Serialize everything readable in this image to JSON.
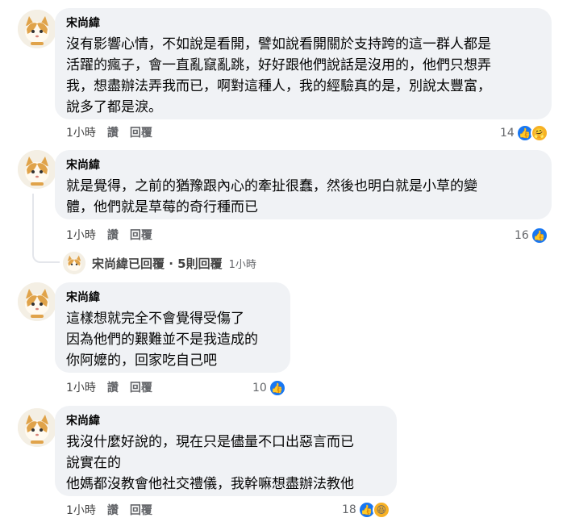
{
  "comments": [
    {
      "author": "宋尚緯",
      "lines": [
        "沒有影響心情，不如說是看開，譬如說看開關於支持跨的這一群人都是",
        "活躍的瘋子，會一直亂竄亂跳，好好跟他們說話是沒用的，他們只想弄",
        "我，想盡辦法弄我而已，啊對這種人，我的經驗真的是，別說太豐富，",
        "說多了都是淚。"
      ],
      "time": "1小時",
      "like_label": "讚",
      "reply_label": "回覆",
      "reaction_count": "14"
    },
    {
      "author": "宋尚緯",
      "lines": [
        "就是覺得，之前的猶豫跟內心的牽扯很蠢，然後也明白就是小草的變",
        "體，他們就是草莓的奇行種而已"
      ],
      "time": "1小時",
      "like_label": "讚",
      "reply_label": "回覆",
      "reaction_count": "16"
    },
    {
      "author": "宋尚緯",
      "lines": [
        "這樣想就完全不會覺得受傷了",
        "因為他們的艱難並不是我造成的",
        "你阿嬤的，回家吃自己吧"
      ],
      "time": "1小時",
      "like_label": "讚",
      "reply_label": "回覆",
      "reaction_count": "10"
    },
    {
      "author": "宋尚緯",
      "lines": [
        "我沒什麼好說的，現在只是儘量不口出惡言而已",
        "說實在的",
        "他媽都沒教會他社交禮儀，我幹嘛想盡辦法教他"
      ],
      "time": "1小時",
      "like_label": "讚",
      "reply_label": "回覆",
      "reaction_count": "18"
    }
  ],
  "replies_summary": {
    "text": "宋尚緯已回覆 · 5則回覆",
    "time": "1小時"
  },
  "colors": {
    "bubble": "#f0f2f5",
    "like_blue": "#1877f2",
    "meta_gray": "#65676b"
  }
}
